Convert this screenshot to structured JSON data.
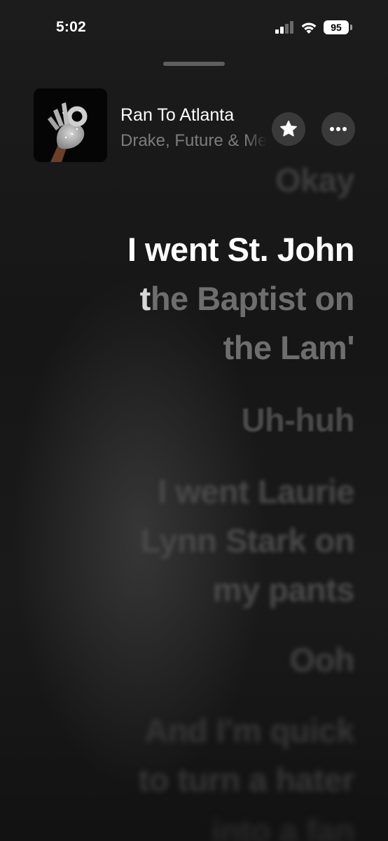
{
  "status_bar": {
    "time": "5:02",
    "battery": "95",
    "icons": [
      "signal-icon",
      "wifi-icon",
      "battery-icon"
    ]
  },
  "now_playing": {
    "title": "Ran To Atlanta",
    "artist": "Drake, Future & Metro Boomin",
    "artwork_icon": "album-artwork-hand-icon",
    "favorite_icon": "star-icon",
    "more_icon": "ellipsis-icon"
  },
  "lyrics": {
    "previous": "Okay",
    "current": {
      "sung": "I went St. John\n",
      "partial": "t",
      "unsung": "he Baptist on\nthe Lam'",
      "lead": ""
    },
    "upcoming": [
      "Uh-huh",
      "I went Laurie\nLynn Stark on\nmy pants",
      "Ooh",
      "And I'm quick\nto turn a hater",
      "into a fan"
    ]
  },
  "colors": {
    "background": "#141414",
    "active_lyric": "#ffffff",
    "inactive_lyric": "#6e6e6e",
    "secondary_text": "#7d7d7d"
  }
}
